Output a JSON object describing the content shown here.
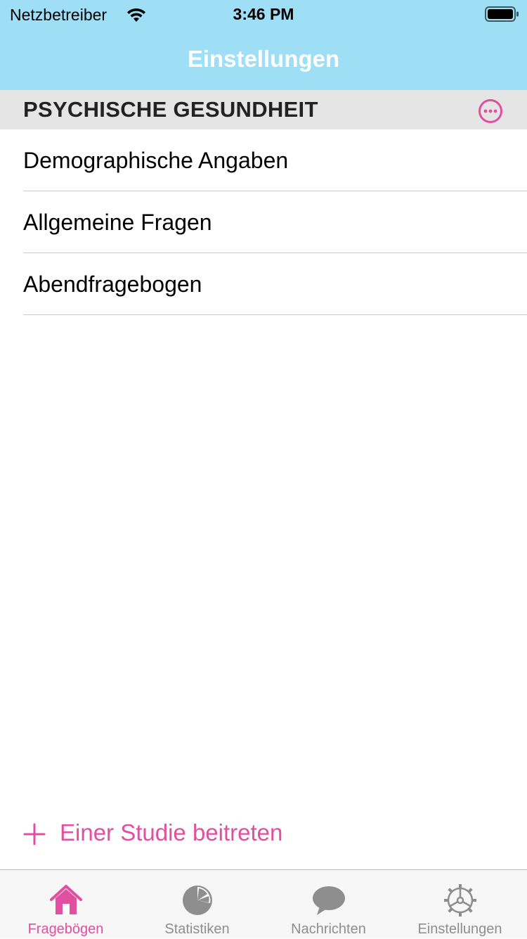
{
  "status_bar": {
    "carrier": "Netzbetreiber",
    "time": "3:46 PM"
  },
  "nav": {
    "title": "Einstellungen"
  },
  "section": {
    "title": "PSYCHISCHE GESUNDHEIT",
    "more_icon": "more-circle-icon"
  },
  "list": {
    "items": [
      {
        "label": "Demographische Angaben"
      },
      {
        "label": "Allgemeine Fragen"
      },
      {
        "label": "Abendfragebogen"
      }
    ]
  },
  "join": {
    "label": "Einer Studie beitreten",
    "icon": "plus-icon"
  },
  "tabs": [
    {
      "label": "Fragebögen",
      "icon": "home-icon",
      "active": true
    },
    {
      "label": "Statistiken",
      "icon": "pie-chart-icon",
      "active": false
    },
    {
      "label": "Nachrichten",
      "icon": "chat-bubble-icon",
      "active": false
    },
    {
      "label": "Einstellungen",
      "icon": "gear-icon",
      "active": false
    }
  ],
  "colors": {
    "header": "#9fdff5",
    "accent": "#e04fa0",
    "section_bg": "#e5e5e5",
    "tab_inactive": "#8e8e8e"
  }
}
